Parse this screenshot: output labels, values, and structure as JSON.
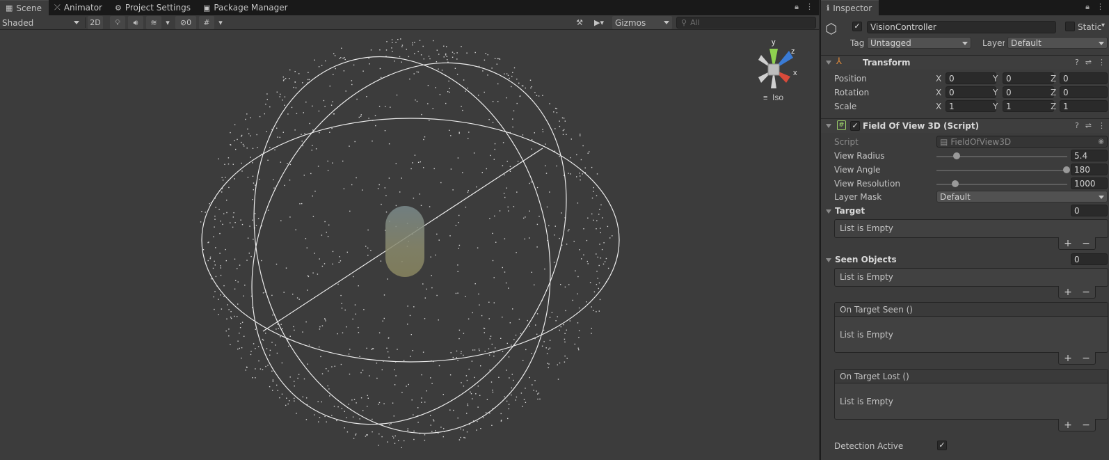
{
  "scene_tabs": [
    {
      "label": "Scene",
      "icon": "grid-icon"
    },
    {
      "label": "Animator",
      "icon": "animator-icon"
    },
    {
      "label": "Project Settings",
      "icon": "gear-icon"
    },
    {
      "label": "Package Manager",
      "icon": "package-icon"
    }
  ],
  "toolbar": {
    "shading_mode": "Shaded",
    "mode_2d": "2D",
    "hidden_count": "0",
    "gizmos": "Gizmos",
    "search_placeholder": "All"
  },
  "gizmo": {
    "y": "y",
    "z": "z",
    "x": "x",
    "projection": "Iso"
  },
  "inspector": {
    "tab": "Inspector",
    "object_name": "VisionController",
    "static_label": "Static",
    "tag_label": "Tag",
    "tag_value": "Untagged",
    "layer_label": "Layer",
    "layer_value": "Default",
    "transform": {
      "title": "Transform",
      "rows": [
        {
          "label": "Position",
          "x": "0",
          "y": "0",
          "z": "0"
        },
        {
          "label": "Rotation",
          "x": "0",
          "y": "0",
          "z": "0"
        },
        {
          "label": "Scale",
          "x": "1",
          "y": "1",
          "z": "1"
        }
      ],
      "axis_x": "X",
      "axis_y": "Y",
      "axis_z": "Z"
    },
    "fov": {
      "title": "Field Of View 3D (Script)",
      "script_label": "Script",
      "script_value": "FieldOfView3D",
      "view_radius_label": "View Radius",
      "view_radius": "5.4",
      "view_radius_fraction": 0.13,
      "view_angle_label": "View Angle",
      "view_angle": "180",
      "view_angle_fraction": 1.0,
      "view_resolution_label": "View Resolution",
      "view_resolution": "1000",
      "view_resolution_fraction": 0.12,
      "layer_mask_label": "Layer Mask",
      "layer_mask": "Default",
      "target_label": "Target",
      "target_count": "0",
      "seen_label": "Seen Objects",
      "seen_count": "0",
      "list_empty": "List is Empty",
      "on_target_seen": "On Target Seen ()",
      "on_target_lost": "On Target Lost ()",
      "detection_active_label": "Detection Active",
      "plus": "+",
      "minus": "−"
    }
  },
  "colors": {
    "scene_bg": "#3c3c3c",
    "wire": "#e8e8e8",
    "gizmo_y": "#8fd14f",
    "gizmo_z": "#3a7bd5",
    "gizmo_x": "#d84a3a"
  }
}
